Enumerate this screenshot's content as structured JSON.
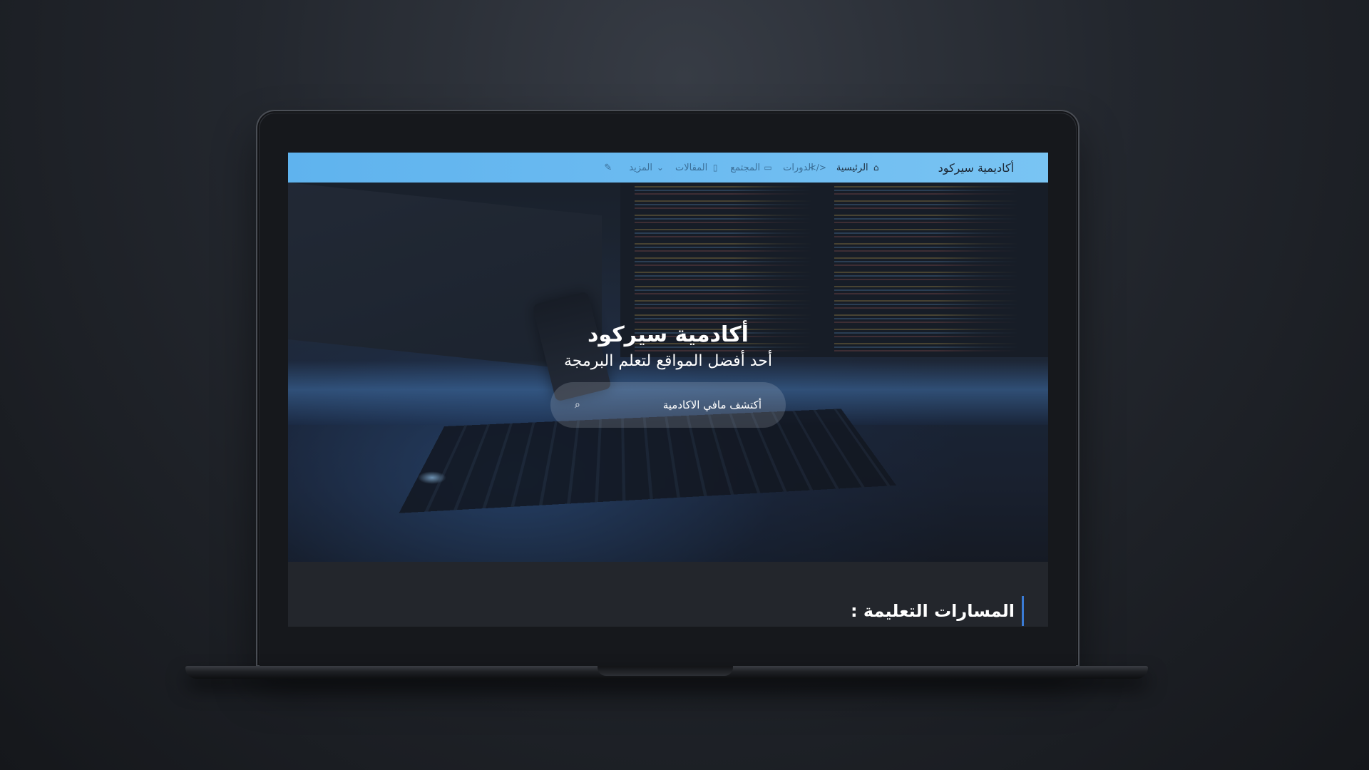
{
  "navbar": {
    "brand": "أكاديمية سيركود",
    "items": [
      {
        "label": "الرئيسية",
        "icon": "home-icon"
      },
      {
        "label": "الدورات",
        "icon": "code-icon"
      },
      {
        "label": "المجتمع",
        "icon": "chat-icon"
      },
      {
        "label": "المقالات",
        "icon": "document-icon"
      },
      {
        "label": "المزيد",
        "icon": "chevron-down-icon"
      }
    ],
    "edit_icon": "pencil-icon"
  },
  "hero": {
    "title": "أكادمية سيركود",
    "subtitle": "أحد أفضل المواقع لتعلم البرمجة",
    "search_placeholder": "أكتشف مافي الاكادمية",
    "search_icon": "search-icon"
  },
  "section": {
    "title": "المسارات التعليمة :"
  },
  "colors": {
    "navbar": "#6ebcf1",
    "accent": "#3a7bd5",
    "section_bg": "#23262c"
  }
}
